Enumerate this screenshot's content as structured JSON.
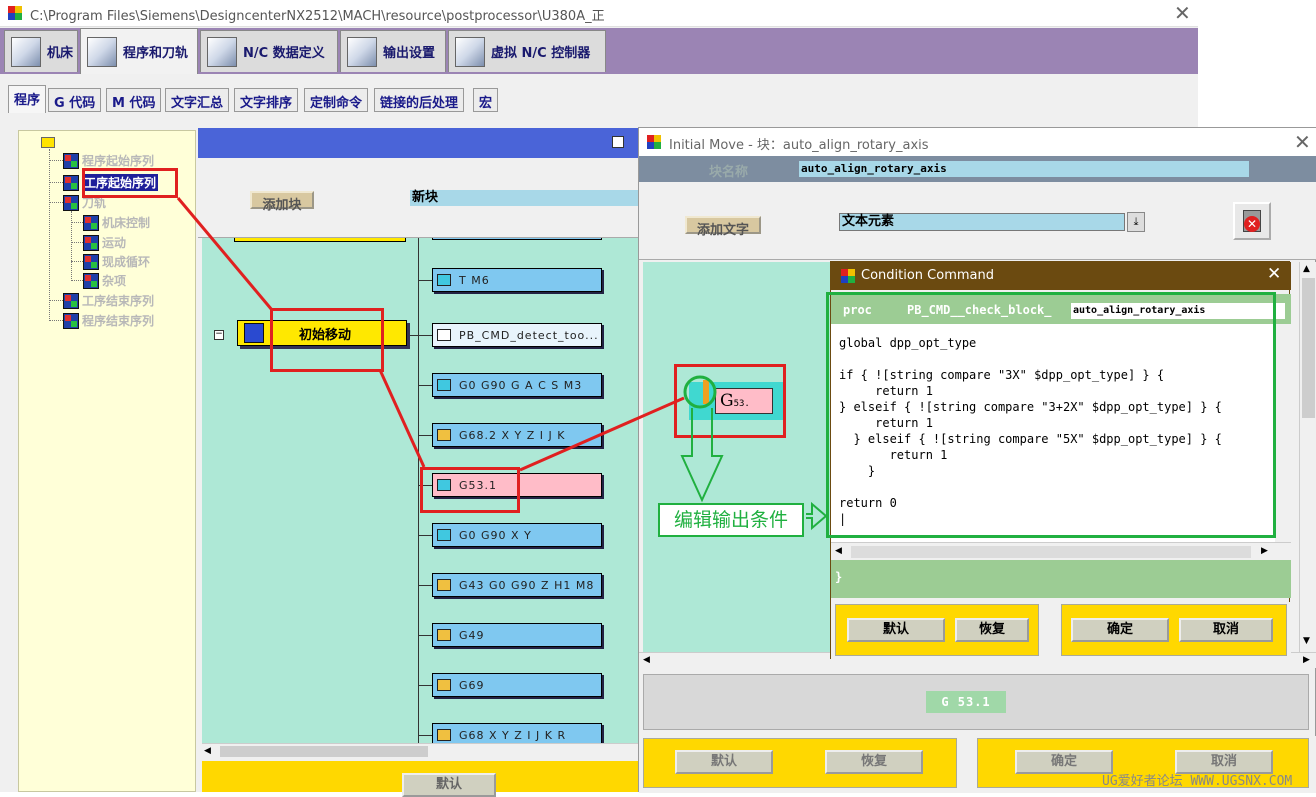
{
  "window": {
    "title": "C:\\Program Files\\Siemens\\DesigncenterNX2512\\MACH\\resource\\postprocessor\\U380A_正"
  },
  "main_tabs": [
    {
      "label": "机床"
    },
    {
      "label": "程序和刀轨"
    },
    {
      "label": "N/C 数据定义"
    },
    {
      "label": "输出设置"
    },
    {
      "label": "虚拟 N/C 控制器"
    }
  ],
  "sub_tabs": [
    {
      "label": "程序"
    },
    {
      "label": "G 代码"
    },
    {
      "label": "M 代码"
    },
    {
      "label": "文字汇总"
    },
    {
      "label": "文字排序"
    },
    {
      "label": "定制命令"
    },
    {
      "label": "链接的后处理"
    },
    {
      "label": "宏"
    }
  ],
  "tree": {
    "items": [
      {
        "label": "程序起始序列"
      },
      {
        "label": "工序起始序列"
      },
      {
        "label": "刀轨"
      },
      {
        "label": "机床控制"
      },
      {
        "label": "运动"
      },
      {
        "label": "现成循环"
      },
      {
        "label": "杂项"
      },
      {
        "label": "工序结束序列"
      },
      {
        "label": "程序结束序列"
      }
    ]
  },
  "canvas": {
    "add_block_label": "添加块",
    "new_block_value": "新块",
    "block_node_label": "初始移动",
    "default_label": "默认",
    "words": [
      {
        "text": "T M6"
      },
      {
        "text": "PB_CMD_detect_too..."
      },
      {
        "text": "G0 G90 G A C S M3"
      },
      {
        "text": "G68.2 X Y Z I J K"
      },
      {
        "text": "G53.1"
      },
      {
        "text": "G0 G90 X Y"
      },
      {
        "text": "G43 G0 G90 Z H1 M8"
      },
      {
        "text": "G49"
      },
      {
        "text": "G69"
      },
      {
        "text": "G68 X Y Z I J K R"
      }
    ]
  },
  "initial_move_dialog": {
    "title": "Initial Move  -  块：auto_align_rotary_axis",
    "block_name_label": "块名称",
    "block_name_value": "auto_align_rotary_axis",
    "add_text_label": "添加文字",
    "text_element_value": "文本元素",
    "word_G": "G",
    "word_sub": "53.",
    "preview_value": "G  53.1",
    "buttons": {
      "default": "默认",
      "restore": "恢复",
      "ok": "确定",
      "cancel": "取消"
    }
  },
  "condition_dialog": {
    "title": "Condition Command",
    "proc_keyword": "proc",
    "proc_prefix": "PB_CMD__check_block_",
    "proc_name": "auto_align_rotary_axis",
    "code_lines": [
      "global dpp_opt_type",
      "",
      "if { ![string compare \"3X\" $dpp_opt_type] } {",
      "     return 1",
      "} elseif { ![string compare \"3+2X\" $dpp_opt_type] } {",
      "     return 1",
      "  } elseif { ![string compare \"5X\" $dpp_opt_type] } {",
      "       return 1",
      "    }",
      "",
      "return 0",
      "|"
    ],
    "closing_brace": "}",
    "buttons": {
      "default": "默认",
      "restore": "恢复",
      "ok": "确定",
      "cancel": "取消"
    }
  },
  "annotation_label": "编辑输出条件",
  "watermark": "UG爱好者论坛 WWW.UGSNX.COM"
}
